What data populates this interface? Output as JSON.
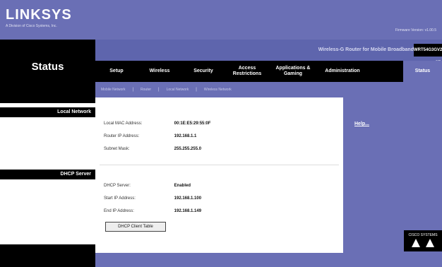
{
  "brand": {
    "logo": "LINKSYS",
    "subtitle": "A Division of Cisco Systems, Inc.",
    "firmware": "Firmware Version: v1.00.5"
  },
  "header": {
    "product": "Wireless-G Router for Mobile Broadband",
    "model": "WRT54G3GV2-ST"
  },
  "page_title": "Status",
  "nav": {
    "items": [
      {
        "label": "Setup"
      },
      {
        "label": "Wireless"
      },
      {
        "label": "Security"
      },
      {
        "label": "Access Restrictions"
      },
      {
        "label": "Applications & Gaming"
      },
      {
        "label": "Administration"
      },
      {
        "label": "Status"
      }
    ]
  },
  "subnav": {
    "items": [
      "Mobile Network",
      "Router",
      "Local Network",
      "Wireless Network"
    ]
  },
  "sections": {
    "local_network": "Local Network",
    "dhcp_server": "DHCP Server"
  },
  "local_network": {
    "mac_label": "Local MAC Address:",
    "mac_value": "00:1E:E5:29:55:0F",
    "ip_label": "Router IP Address:",
    "ip_value": "192.168.1.1",
    "mask_label": "Subnet Mask:",
    "mask_value": "255.255.255.0"
  },
  "dhcp": {
    "server_label": "DHCP Server:",
    "server_value": "Enabled",
    "start_label": "Start IP Address:",
    "start_value": "192.168.1.100",
    "end_label": "End IP Address:",
    "end_value": "192.168.1.149",
    "table_button": "DHCP Client Table"
  },
  "help": {
    "link": "Help..."
  },
  "footer": {
    "cisco": "CISCO SYSTEMS"
  }
}
